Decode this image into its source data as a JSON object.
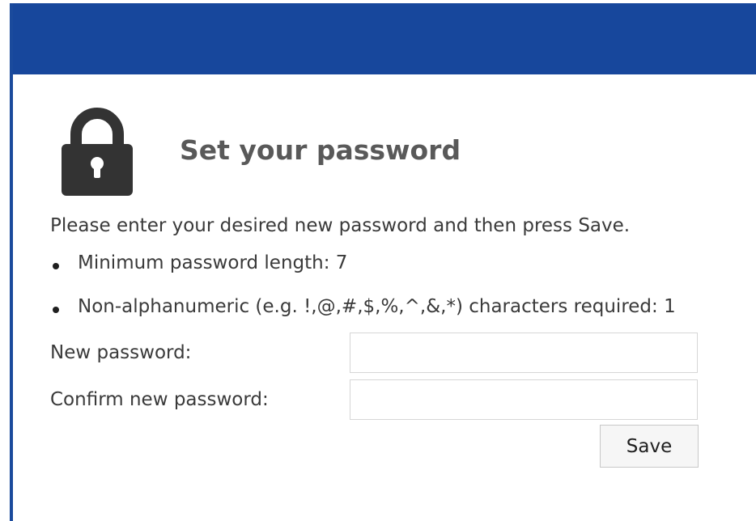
{
  "header": {
    "color": "#17479c"
  },
  "panel": {
    "icon": "lock-icon",
    "title": "Set your password",
    "intro": "Please enter your desired new password and then press Save.",
    "rules": [
      "Minimum password length: 7",
      "Non-alphanumeric (e.g. !,@,#,$,%,^,&,*) characters required: 1"
    ]
  },
  "form": {
    "new_password": {
      "label": "New password:",
      "value": "",
      "placeholder": ""
    },
    "confirm_password": {
      "label": "Confirm new password:",
      "value": "",
      "placeholder": ""
    },
    "save_label": "Save"
  }
}
